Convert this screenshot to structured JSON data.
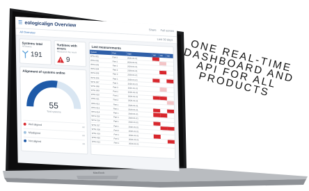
{
  "app": {
    "title": "eologicalign Overview",
    "header_right": [
      "Share",
      "Full screen"
    ],
    "subbar_item": "All Overview",
    "subbar_right": "Last 30 days"
  },
  "cards": {
    "systems_total": {
      "title": "Systems total",
      "subtitle": "All Assets",
      "value": "191",
      "icon": "antenna-icon"
    },
    "turbines_alerts": {
      "title": "Turbines with errors",
      "subtitle": "Measured this week",
      "value": "9",
      "icon": "warning-triangle-icon"
    },
    "alignment": {
      "title": "Alignment of systems online",
      "value": "55",
      "label": "Total systems",
      "gauge_fraction": 0.55,
      "legend": [
        {
          "label": "Well aligned",
          "value": "xx",
          "color": "#d8262c"
        },
        {
          "label": "Misaligned",
          "value": "xx",
          "color": "#9ec1df"
        },
        {
          "label": "Not aligned",
          "value": "xx",
          "color": "#1e5aa8"
        }
      ]
    }
  },
  "table": {
    "title": "Last measurements",
    "headers": [
      "System",
      "Part",
      "Date",
      "Val",
      "Val",
      "Val"
    ],
    "rows": [
      [
        "WTG 001",
        "Part 1",
        "2020-01-01",
        "red",
        "",
        ""
      ],
      [
        "WTG 002",
        "Part 1",
        "2020-01-01",
        "",
        "pink",
        ""
      ],
      [
        "WTG 003",
        "Part 1",
        "2020-01-01",
        "",
        "",
        ""
      ],
      [
        "WTG 004",
        "Part 2",
        "2020-01-01",
        "",
        "red",
        ""
      ],
      [
        "WTG 005",
        "Part 2",
        "2020-01-01",
        "",
        "",
        ""
      ],
      [
        "WTG 006",
        "Part 1",
        "2020-01-01",
        "red",
        "",
        "red"
      ],
      [
        "WTG 007",
        "Part 1",
        "2020-01-01",
        "",
        "",
        ""
      ],
      [
        "WTG 008",
        "Part 3",
        "2020-01-01",
        "",
        "pink",
        ""
      ],
      [
        "WTG 009",
        "Part 1",
        "2020-01-01",
        "",
        "",
        ""
      ],
      [
        "WTG 010",
        "Part 1",
        "2020-01-01",
        "red",
        "red",
        ""
      ],
      [
        "WTG 011",
        "Part 2",
        "2020-01-01",
        "",
        "",
        "pink"
      ],
      [
        "WTG 012",
        "Part 1",
        "2020-01-01",
        "",
        "",
        ""
      ],
      [
        "WTG 013",
        "Part 1",
        "2020-01-01",
        "red",
        "",
        "red"
      ],
      [
        "WTG 014",
        "Part 1",
        "2020-01-01",
        "red",
        "red",
        ""
      ],
      [
        "WTG 015",
        "Part 3",
        "2020-01-01",
        "",
        "",
        ""
      ],
      [
        "WTG 016",
        "Part 1",
        "2020-01-01",
        "red",
        "",
        ""
      ],
      [
        "WTG 017",
        "Part 1",
        "2020-01-01",
        "",
        "red",
        "red"
      ],
      [
        "WTG 018",
        "Part 2",
        "2020-01-01",
        "",
        "",
        ""
      ],
      [
        "WTG 019",
        "Part 1",
        "2020-01-01",
        "red",
        "",
        ""
      ],
      [
        "WTG 020",
        "Part 1",
        "2020-01-01",
        "",
        "",
        "red"
      ],
      [
        "WTG 021",
        "Part 1",
        "2020-01-01",
        "",
        "",
        ""
      ]
    ]
  },
  "tagline": [
    "ONE REAL-TIME",
    "DASHBOARD AND",
    "API FOR ALL",
    "PRODUCTS"
  ],
  "laptop_brand": "MacBook"
}
